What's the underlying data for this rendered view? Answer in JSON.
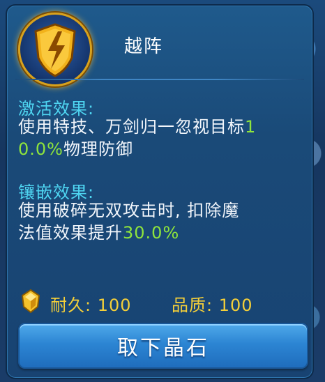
{
  "item": {
    "name": "越阵",
    "icon": "shield-lightning-icon"
  },
  "activation": {
    "title": "激活效果:",
    "line1_pre": "使用特技、万剑归一忽视目标",
    "line1_hl": "1",
    "line2_hl": "0.0%",
    "line2_post": "物理防御"
  },
  "inlay": {
    "title": "镶嵌效果:",
    "line1": "使用破碎无双攻击时, 扣除魔",
    "line2_pre": "法值效果提升",
    "line2_hl": "30.0%"
  },
  "stats": {
    "durability": "耐久: 100",
    "quality": "品质: 100"
  },
  "actions": {
    "remove_label": "取下晶石"
  },
  "colors": {
    "title": "#ffffff",
    "section": "#4fd6f2",
    "highlight": "#8fe53c",
    "stat": "#f4cf39",
    "button": "#2c85d3"
  }
}
